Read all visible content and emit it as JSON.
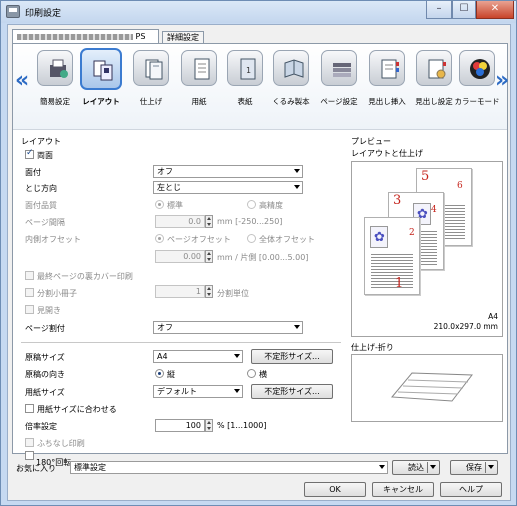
{
  "window": {
    "title": "印刷設定",
    "controls": [
      "minimize",
      "maximize",
      "close"
    ]
  },
  "tabs": [
    {
      "label": "PS",
      "blurred_prefix": true
    },
    {
      "label": "詳細設定"
    }
  ],
  "function_icons": [
    {
      "label": "簡易設定",
      "icon": "quick-settings-icon"
    },
    {
      "label": "レイアウト",
      "icon": "layout-icon",
      "selected": true
    },
    {
      "label": "仕上げ",
      "icon": "finishing-icon"
    },
    {
      "label": "用紙",
      "icon": "paper-icon"
    },
    {
      "label": "表紙",
      "icon": "cover-icon"
    },
    {
      "label": "くるみ製本",
      "icon": "perfect-binding-icon"
    },
    {
      "label": "ページ設定",
      "icon": "page-setup-icon"
    },
    {
      "label": "見出し挿入",
      "icon": "tab-insert-icon"
    },
    {
      "label": "見出し設定",
      "icon": "tab-settings-icon"
    },
    {
      "label": "カラーモード",
      "icon": "color-mode-icon"
    }
  ],
  "layout": {
    "section_title": "レイアウト",
    "duplex": {
      "label": "両面",
      "checked": true
    },
    "side": {
      "label": "面付",
      "value": "オフ"
    },
    "binding": {
      "label": "とじ方向",
      "value": "左とじ"
    },
    "imposition_quality": {
      "label": "面付品質",
      "options": [
        "標準",
        "高精度"
      ],
      "selected": "標準"
    },
    "page_spacing": {
      "label": "ページ間隔",
      "value": "0.0",
      "unit": "mm [-250...250]"
    },
    "inner_offset": {
      "label": "内側オフセット",
      "options": [
        "ページオフセット",
        "全体オフセット"
      ],
      "selected": "ページオフセット",
      "value": "0.00",
      "unit": "mm / 片側 [0.00...5.00]"
    },
    "last_page_back_cover": {
      "label": "最終ページの裏カバー印刷"
    },
    "split_booklet": {
      "label": "分割小冊子",
      "value": "1",
      "unit": "分割単位"
    },
    "spread": {
      "label": "見開き"
    },
    "page_split": {
      "label": "ページ割付",
      "value": "オフ"
    }
  },
  "paper": {
    "original_size": {
      "label": "原稿サイズ",
      "value": "A4",
      "button": "不定形サイズ..."
    },
    "orientation": {
      "label": "原稿の向き",
      "options": [
        "縦",
        "横"
      ],
      "selected": "縦"
    },
    "paper_size": {
      "label": "用紙サイズ",
      "value": "デフォルト",
      "button": "不定形サイズ..."
    },
    "fit_to_paper": {
      "label": "用紙サイズに合わせる"
    },
    "scale": {
      "label": "倍率設定",
      "value": "100",
      "unit": "% [1...1000]"
    },
    "borderless": {
      "label": "ふちなし印刷"
    },
    "rotate180": {
      "label": "180°回転"
    }
  },
  "preview": {
    "title": "プレビュー",
    "layout_title": "レイアウトと仕上げ",
    "paper_label": "A4",
    "paper_dims": "210.0x297.0 mm",
    "finishing_title": "仕上げ-折り",
    "page_numbers": [
      "1",
      "2",
      "3",
      "4",
      "5",
      "6"
    ]
  },
  "favorites": {
    "label": "お気に入り",
    "value": "標準設定",
    "load": "読込",
    "save": "保存"
  },
  "footer": {
    "ok": "OK",
    "cancel": "キャンセル",
    "help": "ヘルプ"
  }
}
